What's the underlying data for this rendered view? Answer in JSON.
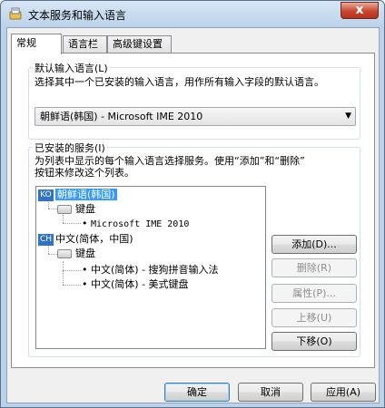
{
  "window": {
    "title": "文本服务和输入语言",
    "close_glyph": "x"
  },
  "tabs": [
    {
      "label": "常规",
      "active": true
    },
    {
      "label": "语言栏",
      "active": false
    },
    {
      "label": "高级键设置",
      "active": false
    }
  ],
  "default_language": {
    "group_label": "默认输入语言(L)",
    "description": "选择其中一个已安装的输入语言，用作所有输入字段的默认语言。",
    "selected": "朝鲜语(韩国) - Microsoft IME 2010"
  },
  "installed_services": {
    "group_label": "已安装的服务(I)",
    "description_line1": "为列表中显示的每个输入语言选择服务。使用“添加”和“删除”",
    "description_line2": "按钮来修改这个列表。",
    "tree": {
      "korean": {
        "badge": "KO",
        "label": "朝鲜语(韩国)",
        "keyboard_label": "键盘",
        "service": "Microsoft IME 2010"
      },
      "chinese": {
        "badge": "CH",
        "label": "中文(简体，中国)",
        "keyboard_label": "键盘",
        "services": [
          "中文(简体) - 搜狗拼音输入法",
          "中文(简体) - 美式键盘"
        ]
      }
    },
    "buttons": {
      "add": "添加(D)...",
      "remove": "删除(R)",
      "properties": "属性(P)...",
      "move_up": "上移(U)",
      "move_down": "下移(O)"
    }
  },
  "footer": {
    "ok": "确定",
    "cancel": "取消",
    "apply": "应用(A)"
  },
  "colors": {
    "accent": "#3399ff",
    "titlebar": "#bcd3ea",
    "close": "#c8472f"
  }
}
